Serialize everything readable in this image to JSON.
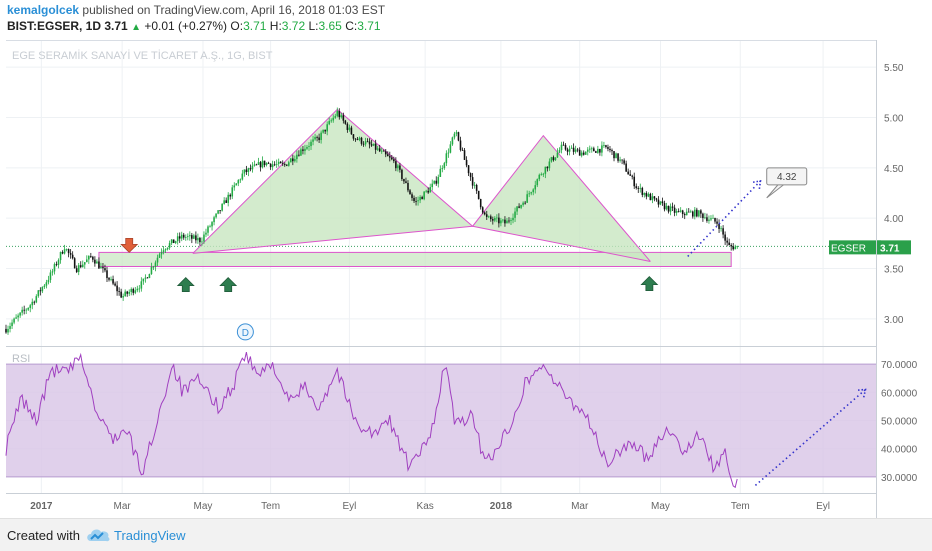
{
  "header": {
    "author": "kemalgolcek",
    "published": "published on TradingView.com, April 16, 2018 01:03 EST",
    "symbol": "BIST:EGSER, 1D",
    "price": "3.71",
    "change": "+0.01 (+0.27%)",
    "o_label": "O:",
    "o": "3.71",
    "h_label": "H:",
    "h": "3.72",
    "l_label": "L:",
    "l": "3.65",
    "c_label": "C:",
    "c": "3.71"
  },
  "footer": {
    "created_with": "Created with",
    "brand": "TradingView"
  },
  "colors": {
    "up": "#22aa44",
    "down": "#111111",
    "pattern": "#dd55cc",
    "pattern_fill": "#c8e6c0",
    "rsi_line": "#a040c0",
    "rsi_band": "#d8c4e6",
    "projection": "#3333cc",
    "label_bg": "#2aa04a",
    "arrow_up": "#2e7d4f",
    "arrow_down": "#e0603a"
  },
  "chart_data": [
    {
      "type": "candlestick",
      "title": "EGE SERAMİK SANAYİ VE TİCARET A.Ş., 1G, BIST",
      "ylim": [
        2.75,
        5.75
      ],
      "y_ticks": [
        "5.50",
        "5.00",
        "4.50",
        "4.00",
        "3.50",
        "3.00"
      ],
      "x_ticks": [
        "2017",
        "Mar",
        "May",
        "Tem",
        "Eyl",
        "Kas",
        "2018",
        "Mar",
        "May",
        "Tem",
        "Eyl"
      ],
      "price_label": {
        "name": "EGSER",
        "value": 3.71
      },
      "anchors": [
        {
          "t": 0,
          "v": 2.9
        },
        {
          "t": 2.5,
          "v": 3.15
        },
        {
          "t": 4.5,
          "v": 3.45
        },
        {
          "t": 5.8,
          "v": 3.72
        },
        {
          "t": 7,
          "v": 3.5
        },
        {
          "t": 8.5,
          "v": 3.62
        },
        {
          "t": 9.8,
          "v": 3.45
        },
        {
          "t": 11.5,
          "v": 3.22
        },
        {
          "t": 13.5,
          "v": 3.35
        },
        {
          "t": 15.5,
          "v": 3.7
        },
        {
          "t": 17.5,
          "v": 3.82
        },
        {
          "t": 19.3,
          "v": 3.78
        },
        {
          "t": 21,
          "v": 4.05
        },
        {
          "t": 23.5,
          "v": 4.45
        },
        {
          "t": 25.5,
          "v": 4.55
        },
        {
          "t": 27.5,
          "v": 4.52
        },
        {
          "t": 29.5,
          "v": 4.7
        },
        {
          "t": 31,
          "v": 4.8
        },
        {
          "t": 32.8,
          "v": 5.05
        },
        {
          "t": 34.5,
          "v": 4.8
        },
        {
          "t": 36.5,
          "v": 4.7
        },
        {
          "t": 38.5,
          "v": 4.55
        },
        {
          "t": 40.5,
          "v": 4.15
        },
        {
          "t": 42.5,
          "v": 4.35
        },
        {
          "t": 43.5,
          "v": 4.6
        },
        {
          "t": 44.5,
          "v": 4.85
        },
        {
          "t": 45.5,
          "v": 4.55
        },
        {
          "t": 47.5,
          "v": 4.0
        },
        {
          "t": 49.5,
          "v": 3.95
        },
        {
          "t": 51.5,
          "v": 4.2
        },
        {
          "t": 53,
          "v": 4.45
        },
        {
          "t": 55,
          "v": 4.7
        },
        {
          "t": 57,
          "v": 4.65
        },
        {
          "t": 59.5,
          "v": 4.7
        },
        {
          "t": 61,
          "v": 4.55
        },
        {
          "t": 62.5,
          "v": 4.3
        },
        {
          "t": 64.5,
          "v": 4.15
        },
        {
          "t": 66.5,
          "v": 4.05
        },
        {
          "t": 68.5,
          "v": 4.05
        },
        {
          "t": 70.5,
          "v": 3.95
        },
        {
          "t": 71.5,
          "v": 3.72
        },
        {
          "t": 72.6,
          "v": 3.71
        }
      ],
      "pattern_points": [
        [
          [
            18.5,
            3.65
          ],
          [
            32.8,
            5.08
          ],
          [
            46.2,
            3.92
          ],
          [
            53.2,
            4.82
          ],
          [
            63.8,
            3.57
          ]
        ],
        [
          [
            18.5,
            3.65
          ],
          [
            46.2,
            3.92
          ]
        ],
        [
          [
            46.2,
            3.92
          ],
          [
            63.8,
            3.57
          ]
        ]
      ],
      "support_zone": {
        "from": 9.2,
        "to": 71.8,
        "low": 3.52,
        "high": 3.66
      },
      "dotted_line_level": 3.72,
      "arrows_up": [
        [
          17.8,
          3.34
        ],
        [
          22,
          3.34
        ],
        [
          63.7,
          3.35
        ]
      ],
      "arrows_down": [
        [
          12.2,
          3.73
        ]
      ],
      "projection": {
        "from": [
          67.5,
          3.62
        ],
        "to": [
          74.7,
          4.37
        ]
      },
      "callout": {
        "value": "4.32",
        "t": 77.3,
        "v": 4.42
      },
      "event_badge": {
        "label": "D",
        "t": 23.7,
        "v": 2.87
      }
    },
    {
      "type": "line",
      "title": "RSI",
      "ylim": [
        25,
        75
      ],
      "y_ticks": [
        "70.0000",
        "60.0000",
        "50.0000",
        "40.0000",
        "30.0000"
      ],
      "band": [
        30,
        70
      ],
      "anchors": [
        {
          "t": 0,
          "v": 40
        },
        {
          "t": 1.5,
          "v": 58
        },
        {
          "t": 3,
          "v": 50
        },
        {
          "t": 4.5,
          "v": 68
        },
        {
          "t": 6,
          "v": 67
        },
        {
          "t": 7.5,
          "v": 72
        },
        {
          "t": 9,
          "v": 52
        },
        {
          "t": 10.5,
          "v": 44
        },
        {
          "t": 12,
          "v": 46
        },
        {
          "t": 13.5,
          "v": 31
        },
        {
          "t": 15.5,
          "v": 57
        },
        {
          "t": 16.5,
          "v": 70
        },
        {
          "t": 17.5,
          "v": 60
        },
        {
          "t": 19,
          "v": 64
        },
        {
          "t": 21,
          "v": 55
        },
        {
          "t": 22.5,
          "v": 62
        },
        {
          "t": 23.5,
          "v": 74
        },
        {
          "t": 25,
          "v": 66
        },
        {
          "t": 26.5,
          "v": 70
        },
        {
          "t": 28,
          "v": 56
        },
        {
          "t": 29.5,
          "v": 62
        },
        {
          "t": 31,
          "v": 55
        },
        {
          "t": 32.8,
          "v": 68
        },
        {
          "t": 34.5,
          "v": 50
        },
        {
          "t": 36.5,
          "v": 45
        },
        {
          "t": 38,
          "v": 50
        },
        {
          "t": 40,
          "v": 33
        },
        {
          "t": 42,
          "v": 44
        },
        {
          "t": 43.5,
          "v": 71
        },
        {
          "t": 44.5,
          "v": 48
        },
        {
          "t": 46,
          "v": 52
        },
        {
          "t": 47.5,
          "v": 35
        },
        {
          "t": 49.5,
          "v": 45
        },
        {
          "t": 51.5,
          "v": 64
        },
        {
          "t": 53.2,
          "v": 70
        },
        {
          "t": 55,
          "v": 60
        },
        {
          "t": 57.5,
          "v": 52
        },
        {
          "t": 59.5,
          "v": 34
        },
        {
          "t": 61.5,
          "v": 42
        },
        {
          "t": 63.5,
          "v": 37
        },
        {
          "t": 65.5,
          "v": 48
        },
        {
          "t": 67,
          "v": 39
        },
        {
          "t": 68.5,
          "v": 45
        },
        {
          "t": 70,
          "v": 34
        },
        {
          "t": 71.3,
          "v": 38
        },
        {
          "t": 71.9,
          "v": 27
        },
        {
          "t": 72.6,
          "v": 27
        }
      ],
      "projection": {
        "from": [
          74.2,
          27
        ],
        "to": [
          85.1,
          61
        ]
      }
    }
  ]
}
